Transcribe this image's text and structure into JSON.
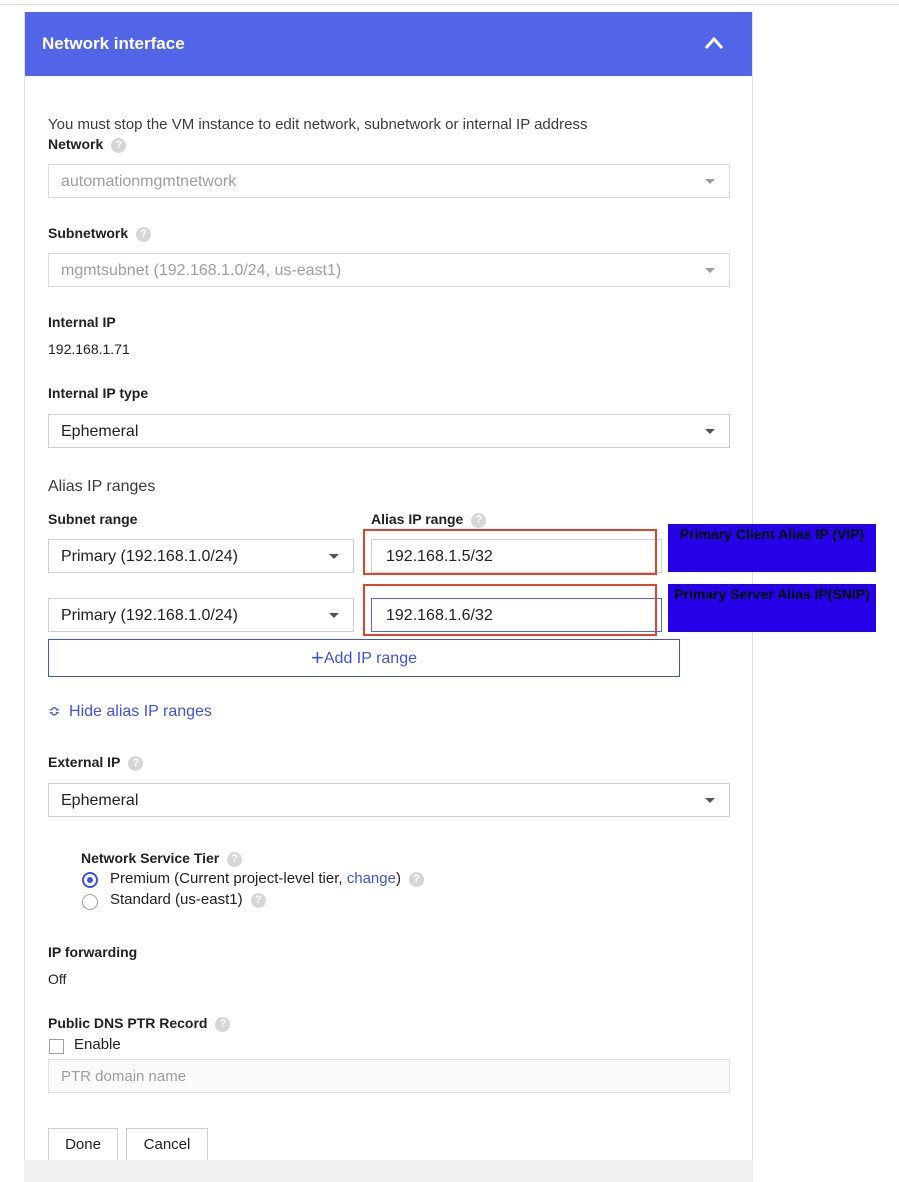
{
  "header": {
    "title": "Network interface"
  },
  "notice": "You must stop the VM instance to edit network, subnetwork or internal IP address",
  "help_glyph": "?",
  "network": {
    "label": "Network",
    "value": "automationmgmtnetwork"
  },
  "subnetwork": {
    "label": "Subnetwork",
    "value": "mgmtsubnet (192.168.1.0/24, us-east1)"
  },
  "internal_ip": {
    "label": "Internal IP",
    "value": "192.168.1.71"
  },
  "internal_ip_type": {
    "label": "Internal IP type",
    "value": "Ephemeral"
  },
  "alias": {
    "section_label": "Alias IP ranges",
    "subnet_range_header": "Subnet range",
    "alias_range_header": "Alias IP range",
    "rows": [
      {
        "subnet_range": "Primary (192.168.1.0/24)",
        "alias_ip": "192.168.1.5/32",
        "callout": "Primary Client Alias IP (VIP)"
      },
      {
        "subnet_range": "Primary (192.168.1.0/24)",
        "alias_ip": "192.168.1.6/32",
        "callout": "Primary Server Alias IP(SNIP)"
      }
    ],
    "add_button": "Add IP range",
    "add_glyph": "+",
    "hide_link": "Hide alias IP ranges",
    "hide_glyph": "≎"
  },
  "external_ip": {
    "label": "External IP",
    "value": "Ephemeral"
  },
  "service_tier": {
    "label": "Network Service Tier",
    "premium_label": "Premium (Current project-level tier,",
    "premium_link": "change",
    "premium_close": ")",
    "standard_label": "Standard (us-east1)",
    "selected": "premium"
  },
  "ip_forwarding": {
    "label": "IP forwarding",
    "value": "Off"
  },
  "ptr": {
    "label": "Public DNS PTR Record",
    "enable_label": "Enable",
    "placeholder": "PTR domain name"
  },
  "buttons": {
    "done": "Done",
    "cancel": "Cancel"
  },
  "colors": {
    "header": "#5265e8",
    "accent": "#3f51e0",
    "callout": "#2600e8",
    "highlight": "#e0442a"
  }
}
